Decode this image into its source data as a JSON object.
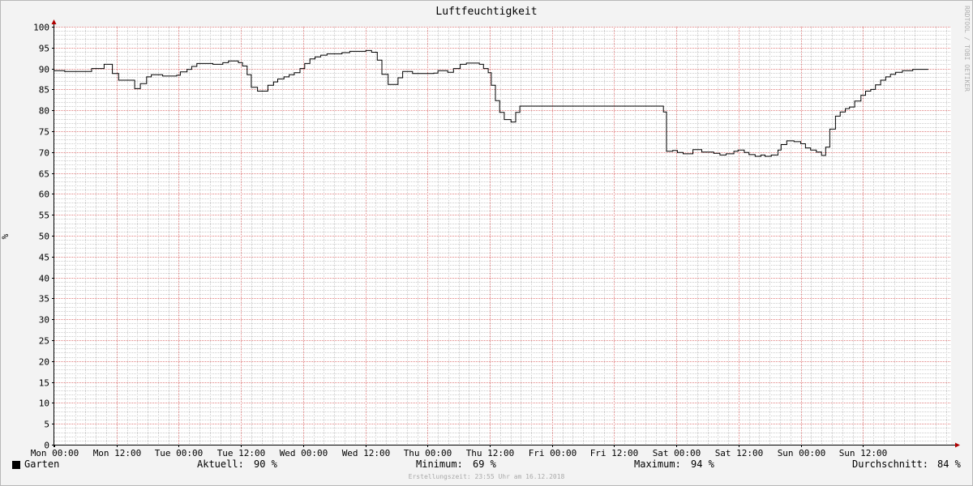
{
  "watermark": "RRDTOOL / TOBI OETIKER",
  "footer": "Erstellungszeit: 23:55 Uhr am 16.12.2018",
  "legend": {
    "series_name": "Garten",
    "current_label": "Aktuell:",
    "current_value": "90 %",
    "min_label": "Minimum:",
    "min_value": "69 %",
    "max_label": "Maximum:",
    "max_value": "94 %",
    "avg_label": "Durchschnitt:",
    "avg_value": "84 %"
  },
  "colors": {
    "background": "#f3f3f3",
    "plot_background": "#ffffff",
    "major_grid": "#e08080",
    "minor_grid": "#cccccc",
    "line": "#000000",
    "axis": "#000000",
    "arrow": "#b00000"
  },
  "chart_data": {
    "type": "line",
    "title": "Luftfeuchtigkeit",
    "ylabel": "%",
    "xlabel": "",
    "ylim": [
      0,
      100
    ],
    "xlim_hours": [
      0,
      173
    ],
    "yticks": [
      0,
      5,
      10,
      15,
      20,
      25,
      30,
      35,
      40,
      45,
      50,
      55,
      60,
      65,
      70,
      75,
      80,
      85,
      90,
      95,
      100
    ],
    "xticks": [
      {
        "t": 0,
        "label": "Mon 00:00"
      },
      {
        "t": 12,
        "label": "Mon 12:00"
      },
      {
        "t": 24,
        "label": "Tue 00:00"
      },
      {
        "t": 36,
        "label": "Tue 12:00"
      },
      {
        "t": 48,
        "label": "Wed 00:00"
      },
      {
        "t": 60,
        "label": "Wed 12:00"
      },
      {
        "t": 72,
        "label": "Thu 00:00"
      },
      {
        "t": 84,
        "label": "Thu 12:00"
      },
      {
        "t": 96,
        "label": "Fri 00:00"
      },
      {
        "t": 108,
        "label": "Fri 12:00"
      },
      {
        "t": 120,
        "label": "Sat 00:00"
      },
      {
        "t": 132,
        "label": "Sat 12:00"
      },
      {
        "t": 144,
        "label": "Sun 00:00"
      },
      {
        "t": 156,
        "label": "Sun 12:00"
      }
    ],
    "grid": true,
    "series": [
      {
        "name": "Garten",
        "step": true,
        "points": [
          [
            0,
            89.5
          ],
          [
            2,
            89.3
          ],
          [
            7.2,
            90.0
          ],
          [
            9.6,
            91.0
          ],
          [
            11.2,
            88.8
          ],
          [
            12.4,
            87.2
          ],
          [
            15.5,
            85.2
          ],
          [
            16.6,
            86.4
          ],
          [
            17.8,
            88.0
          ],
          [
            18.7,
            88.5
          ],
          [
            20.9,
            88.2
          ],
          [
            23.6,
            88.4
          ],
          [
            24.3,
            89.2
          ],
          [
            25.6,
            89.8
          ],
          [
            26.5,
            90.5
          ],
          [
            27.5,
            91.2
          ],
          [
            30.6,
            91.0
          ],
          [
            32.5,
            91.4
          ],
          [
            33.6,
            91.8
          ],
          [
            35.5,
            91.4
          ],
          [
            36.3,
            90.6
          ],
          [
            37.2,
            88.5
          ],
          [
            38.0,
            85.5
          ],
          [
            39.2,
            84.6
          ],
          [
            41.2,
            86.0
          ],
          [
            42.3,
            86.8
          ],
          [
            43.1,
            87.5
          ],
          [
            44.3,
            88.0
          ],
          [
            45.3,
            88.5
          ],
          [
            46.3,
            89.0
          ],
          [
            47.4,
            90.0
          ],
          [
            48.3,
            91.2
          ],
          [
            49.3,
            92.3
          ],
          [
            50.3,
            92.8
          ],
          [
            51.4,
            93.2
          ],
          [
            52.6,
            93.5
          ],
          [
            55.5,
            93.8
          ],
          [
            57.0,
            94.1
          ],
          [
            60.1,
            94.3
          ],
          [
            61.2,
            93.9
          ],
          [
            62.3,
            92.0
          ],
          [
            63.2,
            88.6
          ],
          [
            64.4,
            86.2
          ],
          [
            66.3,
            87.8
          ],
          [
            67.2,
            89.3
          ],
          [
            69.1,
            88.8
          ],
          [
            73.2,
            88.9
          ],
          [
            74.0,
            89.5
          ],
          [
            75.9,
            89.1
          ],
          [
            77.0,
            90.0
          ],
          [
            78.3,
            91.0
          ],
          [
            79.5,
            91.3
          ],
          [
            82.0,
            91.0
          ],
          [
            82.8,
            90.0
          ],
          [
            83.7,
            89.0
          ],
          [
            84.3,
            86.0
          ],
          [
            85.1,
            82.3
          ],
          [
            85.9,
            79.5
          ],
          [
            86.8,
            77.8
          ],
          [
            88.1,
            77.2
          ],
          [
            89.0,
            79.5
          ],
          [
            89.8,
            81.0
          ],
          [
            117.5,
            79.6
          ],
          [
            118.1,
            70.2
          ],
          [
            119.3,
            70.4
          ],
          [
            120.2,
            69.9
          ],
          [
            121.3,
            69.6
          ],
          [
            123.2,
            70.6
          ],
          [
            124.9,
            70.0
          ],
          [
            127.2,
            69.7
          ],
          [
            128.4,
            69.3
          ],
          [
            129.6,
            69.6
          ],
          [
            131.1,
            70.2
          ],
          [
            131.9,
            70.5
          ],
          [
            133.1,
            69.9
          ],
          [
            134.0,
            69.4
          ],
          [
            135.2,
            69.0
          ],
          [
            136.3,
            69.3
          ],
          [
            137.1,
            69.0
          ],
          [
            138.3,
            69.3
          ],
          [
            139.6,
            70.5
          ],
          [
            140.2,
            71.8
          ],
          [
            141.3,
            72.7
          ],
          [
            142.7,
            72.5
          ],
          [
            144.0,
            72.0
          ],
          [
            144.9,
            71.0
          ],
          [
            145.9,
            70.5
          ],
          [
            147.0,
            70.0
          ],
          [
            148.0,
            69.2
          ],
          [
            148.8,
            71.2
          ],
          [
            149.6,
            75.5
          ],
          [
            150.7,
            78.6
          ],
          [
            151.6,
            79.6
          ],
          [
            152.6,
            80.4
          ],
          [
            153.4,
            80.8
          ],
          [
            154.4,
            82.2
          ],
          [
            155.6,
            83.6
          ],
          [
            156.5,
            84.6
          ],
          [
            157.5,
            85.0
          ],
          [
            158.4,
            86.1
          ],
          [
            159.4,
            87.2
          ],
          [
            160.4,
            88.0
          ],
          [
            161.3,
            88.6
          ],
          [
            162.3,
            89.1
          ],
          [
            163.6,
            89.5
          ],
          [
            165.6,
            89.8
          ],
          [
            168.6,
            89.8
          ]
        ]
      }
    ]
  }
}
